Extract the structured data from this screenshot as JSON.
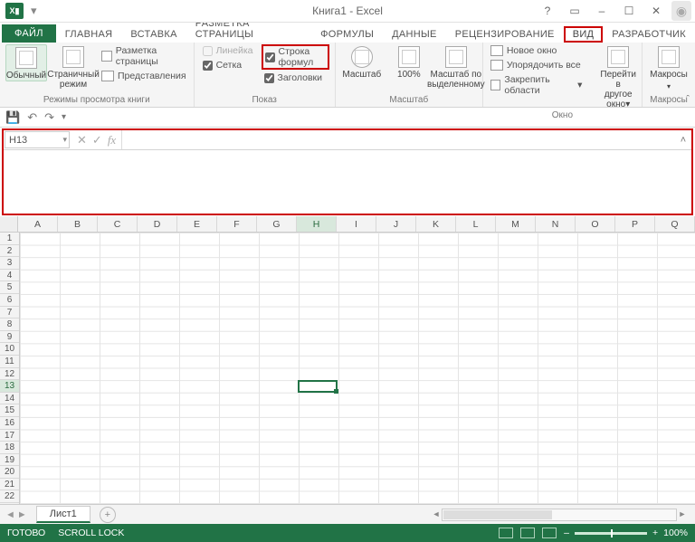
{
  "app": {
    "title": "Книга1 - Excel",
    "xl": "X▮"
  },
  "tabs": {
    "file": "ФАЙЛ",
    "items": [
      "ГЛАВНАЯ",
      "ВСТАВКА",
      "РАЗМЕТКА СТРАНИЦЫ",
      "ФОРМУЛЫ",
      "ДАННЫЕ",
      "РЕЦЕНЗИРОВАНИЕ",
      "ВИД",
      "РАЗРАБОТЧИК"
    ],
    "active_index": 6
  },
  "ribbon": {
    "view_modes": {
      "normal": "Обычный",
      "page_break": "Страничный режим",
      "page_layout": "Разметка страницы",
      "custom": "Представления",
      "group": "Режимы просмотра книги"
    },
    "show": {
      "ruler": "Линейка",
      "formula_bar": "Строка формул",
      "gridlines": "Сетка",
      "headings": "Заголовки",
      "group": "Показ",
      "ruler_checked": false,
      "formula_bar_checked": true,
      "gridlines_checked": true,
      "headings_checked": true
    },
    "zoom": {
      "zoom": "Масштаб",
      "hundred": "100%",
      "to_selection_1": "Масштаб по",
      "to_selection_2": "выделенному",
      "group": "Масштаб"
    },
    "window": {
      "new": "Новое окно",
      "arrange": "Упорядочить все",
      "freeze": "Закрепить области",
      "switch_1": "Перейти в",
      "switch_2": "другое окно",
      "group": "Окно"
    },
    "macros": {
      "label": "Макросы",
      "group": "Макросы"
    }
  },
  "namebox": "H13",
  "columns": [
    "A",
    "B",
    "C",
    "D",
    "E",
    "F",
    "G",
    "H",
    "I",
    "J",
    "K",
    "L",
    "M",
    "N",
    "O",
    "P",
    "Q"
  ],
  "active_col_index": 7,
  "rows": [
    1,
    2,
    3,
    4,
    5,
    6,
    7,
    8,
    9,
    10,
    11,
    12,
    13,
    14,
    15,
    16,
    17,
    18,
    19,
    20,
    21,
    22
  ],
  "active_row_index": 12,
  "sheet": {
    "name": "Лист1"
  },
  "status": {
    "ready": "ГОТОВО",
    "scroll": "SCROLL LOCK",
    "zoom": "100%"
  }
}
